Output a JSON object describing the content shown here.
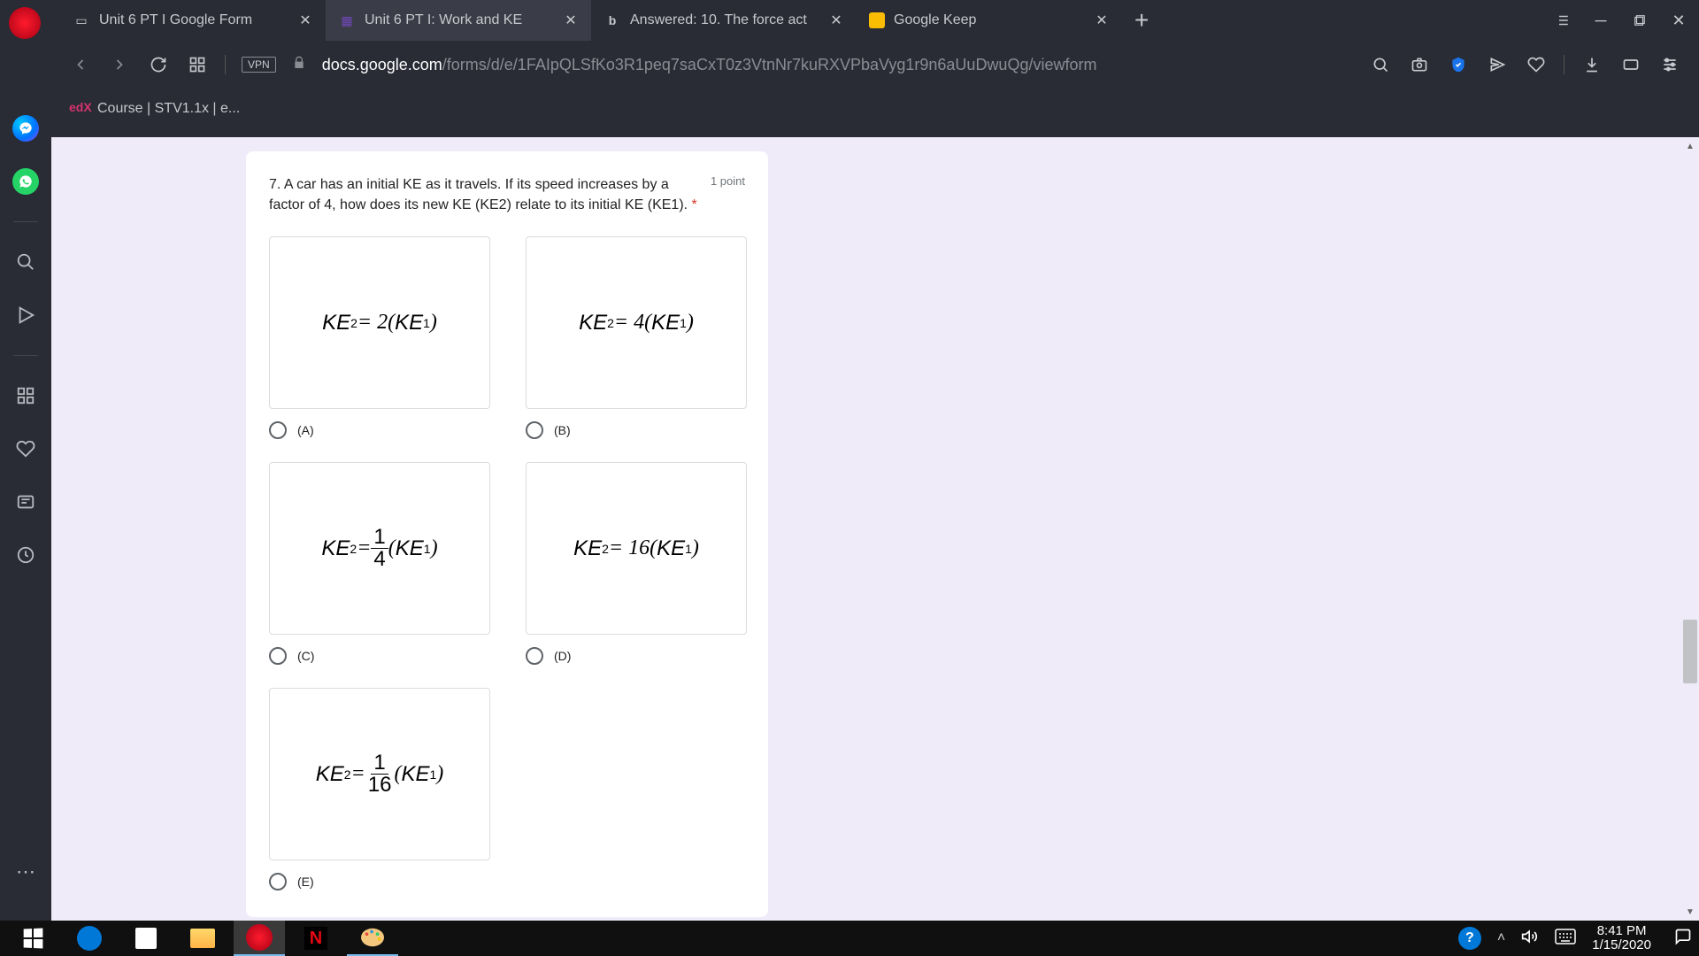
{
  "tabs": [
    {
      "title": "Unit 6 PT I Google Form",
      "icon": "form"
    },
    {
      "title": "Unit 6 PT I: Work and KE",
      "icon": "forms",
      "active": true
    },
    {
      "title": "Answered: 10. The force act",
      "icon": "b"
    },
    {
      "title": "Google Keep",
      "icon": "keep"
    }
  ],
  "address": {
    "host": "docs.google.com",
    "path": "/forms/d/e/1FAIpQLSfKo3R1peq7saCxT0z3VtnNr7kuRXVPbaVyg1r9n6aUuDwuQg/viewform",
    "vpn_label": "VPN"
  },
  "bookmarks": [
    {
      "icon": "edx",
      "title": "Course | STV1.1x | e..."
    }
  ],
  "question": {
    "text": "7. A car has an initial KE as it travels. If its speed increases by a factor of 4, how does its new KE (KE2) relate to its initial KE (KE1).",
    "required_marker": "*",
    "points": "1 point",
    "options": [
      {
        "label": "(A)",
        "formula_html": "<i>KE</i><span class=\"sub\">2</span> = 2(<i>KE</i><span class=\"sub\">1</span>)"
      },
      {
        "label": "(B)",
        "formula_html": "<i>KE</i><span class=\"sub\">2</span> = 4(<i>KE</i><span class=\"sub\">1</span>)"
      },
      {
        "label": "(C)",
        "formula_html": "<i>KE</i><span class=\"sub\">2</span> = <span class=\"frac\"><span class=\"n\">1</span><span class=\"d\">4</span></span>(<i>KE</i><span class=\"sub\">1</span>)"
      },
      {
        "label": "(D)",
        "formula_html": "<i>KE</i><span class=\"sub\">2</span> = 16(<i>KE</i><span class=\"sub\">1</span>)"
      },
      {
        "label": "(E)",
        "formula_html": "<i>KE</i><span class=\"sub\">2</span> = <span class=\"frac\"><span class=\"n\">1</span><span class=\"d\">16</span></span>(<i>KE</i><span class=\"sub\">1</span>)"
      }
    ]
  },
  "netflix_letter": "N",
  "help_symbol": "?",
  "clock": {
    "time": "8:41 PM",
    "date": "1/15/2020"
  }
}
